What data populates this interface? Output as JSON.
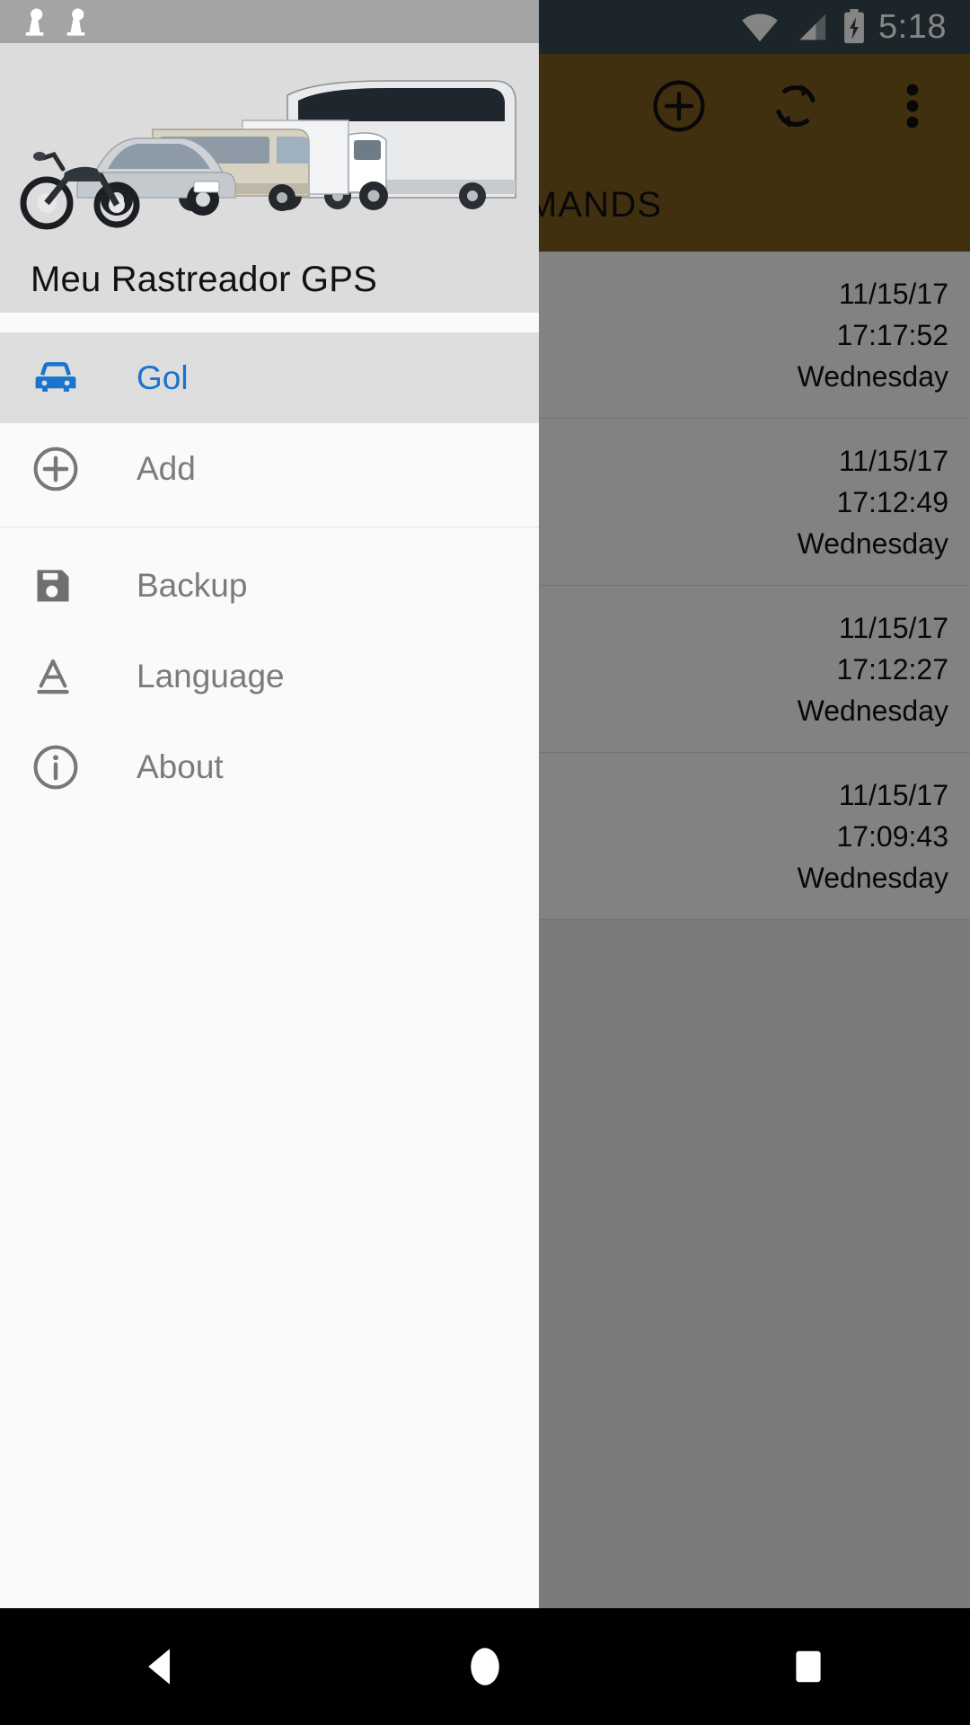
{
  "status_bar": {
    "notification_icons": [
      "satellite-tracker-free-icon",
      "satellite-tracker-icon"
    ],
    "wifi_icon": "wifi-icon",
    "signal_icon": "cellular-signal-icon",
    "battery_icon": "battery-charging-icon",
    "time": "5:18"
  },
  "toolbar": {
    "add_label": "add-circle-icon",
    "sync_label": "sync-icon",
    "overflow_label": "more-vertical-icon",
    "background_color": "#7d5d1d"
  },
  "tabs": {
    "visible_tab_label": "OMMANDS"
  },
  "command_list": {
    "rows": [
      {
        "date": "11/15/17",
        "time": "17:17:52",
        "weekday": "Wednesday"
      },
      {
        "date": "11/15/17",
        "time": "17:12:49",
        "weekday": "Wednesday"
      },
      {
        "date": "11/15/17",
        "time": "17:12:27",
        "weekday": "Wednesday"
      },
      {
        "date": "11/15/17",
        "time": "17:09:43",
        "weekday": "Wednesday"
      }
    ]
  },
  "drawer": {
    "header_title": "Meu Rastreador GPS",
    "header_image": "vehicle-fleet-photo",
    "accent_color": "#1a73cc",
    "items": [
      {
        "label": "Gol",
        "icon": "car-icon",
        "selected": true
      },
      {
        "label": "Add",
        "icon": "add-circle-icon",
        "selected": false
      },
      {
        "label": "Backup",
        "icon": "save-floppy-icon",
        "selected": false
      },
      {
        "label": "Language",
        "icon": "translate-a-icon",
        "selected": false
      },
      {
        "label": "About",
        "icon": "info-circle-icon",
        "selected": false
      }
    ]
  },
  "system_nav": {
    "back": "back-triangle-icon",
    "home": "home-circle-icon",
    "recents": "recents-square-icon"
  }
}
